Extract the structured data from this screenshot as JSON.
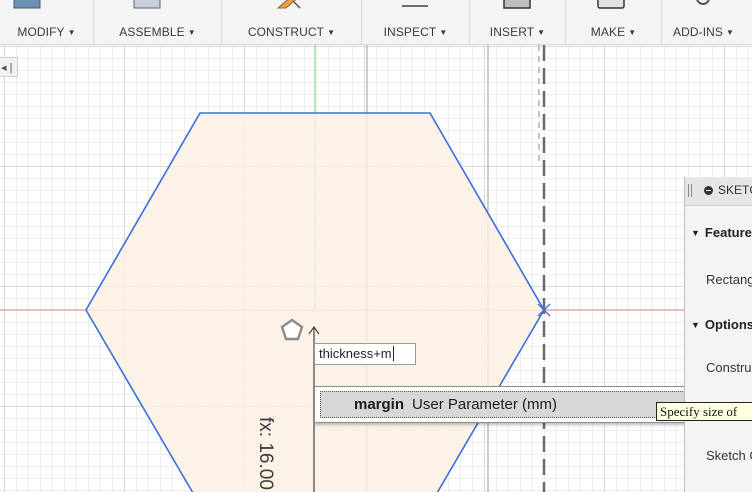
{
  "toolbar": {
    "groups": [
      {
        "label": "MODIFY",
        "icon": "modify-icon"
      },
      {
        "label": "ASSEMBLE",
        "icon": "assemble-icon"
      },
      {
        "label": "CONSTRUCT",
        "icon": "construct-icon"
      },
      {
        "label": "INSPECT",
        "icon": "inspect-icon"
      },
      {
        "label": "INSERT",
        "icon": "insert-icon"
      },
      {
        "label": "MAKE",
        "icon": "make-icon"
      },
      {
        "label": "ADD-INS",
        "icon": "add-ins-icon"
      }
    ],
    "caret": "▼"
  },
  "canvas": {
    "mini_control": "◂ |",
    "dimension_text": "fx: 16.00",
    "dimension_input": {
      "value": "thickness+m"
    },
    "autocomplete": {
      "name": "margin",
      "detail": "User Parameter (mm)"
    },
    "colors": {
      "hexagon_fill": "#fdf0e2",
      "hexagon_stroke": "#3a6fdc",
      "x_axis": "#e39a9a",
      "y_axis": "#8fd68f"
    }
  },
  "palette": {
    "title": "SKETCH PALETTE",
    "sections": [
      {
        "label": "Feature Options",
        "items": [
          "Rectangle"
        ]
      },
      {
        "label": "Options",
        "items": [
          "Construction",
          "Sketch Grid"
        ]
      }
    ],
    "tooltip": "Specify size of"
  }
}
